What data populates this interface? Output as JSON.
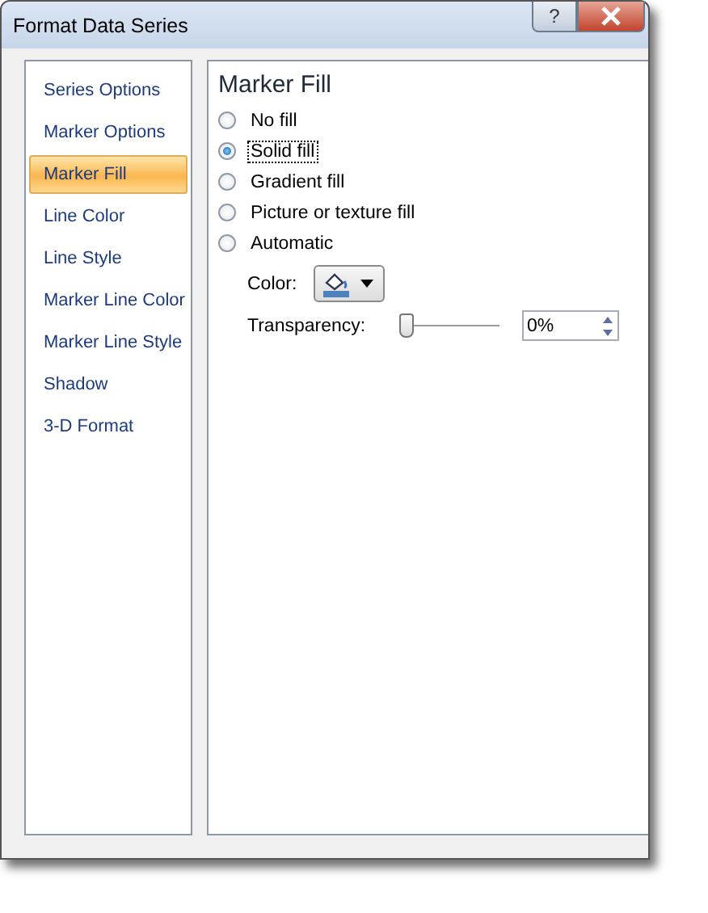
{
  "window": {
    "title": "Format Data Series",
    "help_button": "?"
  },
  "sidebar": {
    "items": [
      {
        "label": "Series Options",
        "selected": false
      },
      {
        "label": "Marker Options",
        "selected": false
      },
      {
        "label": "Marker Fill",
        "selected": true
      },
      {
        "label": "Line Color",
        "selected": false
      },
      {
        "label": "Line Style",
        "selected": false
      },
      {
        "label": "Marker Line Color",
        "selected": false
      },
      {
        "label": "Marker Line Style",
        "selected": false
      },
      {
        "label": "Shadow",
        "selected": false
      },
      {
        "label": "3-D Format",
        "selected": false
      }
    ]
  },
  "panel": {
    "title": "Marker Fill",
    "options": [
      {
        "label": "No fill",
        "selected": false
      },
      {
        "label": "Solid fill",
        "selected": true
      },
      {
        "label": "Gradient fill",
        "selected": false
      },
      {
        "label": "Picture or texture fill",
        "selected": false
      },
      {
        "label": "Automatic",
        "selected": false
      }
    ],
    "color": {
      "label": "Color:"
    },
    "transparency": {
      "label": "Transparency:",
      "level": 0,
      "value": "0%"
    }
  }
}
